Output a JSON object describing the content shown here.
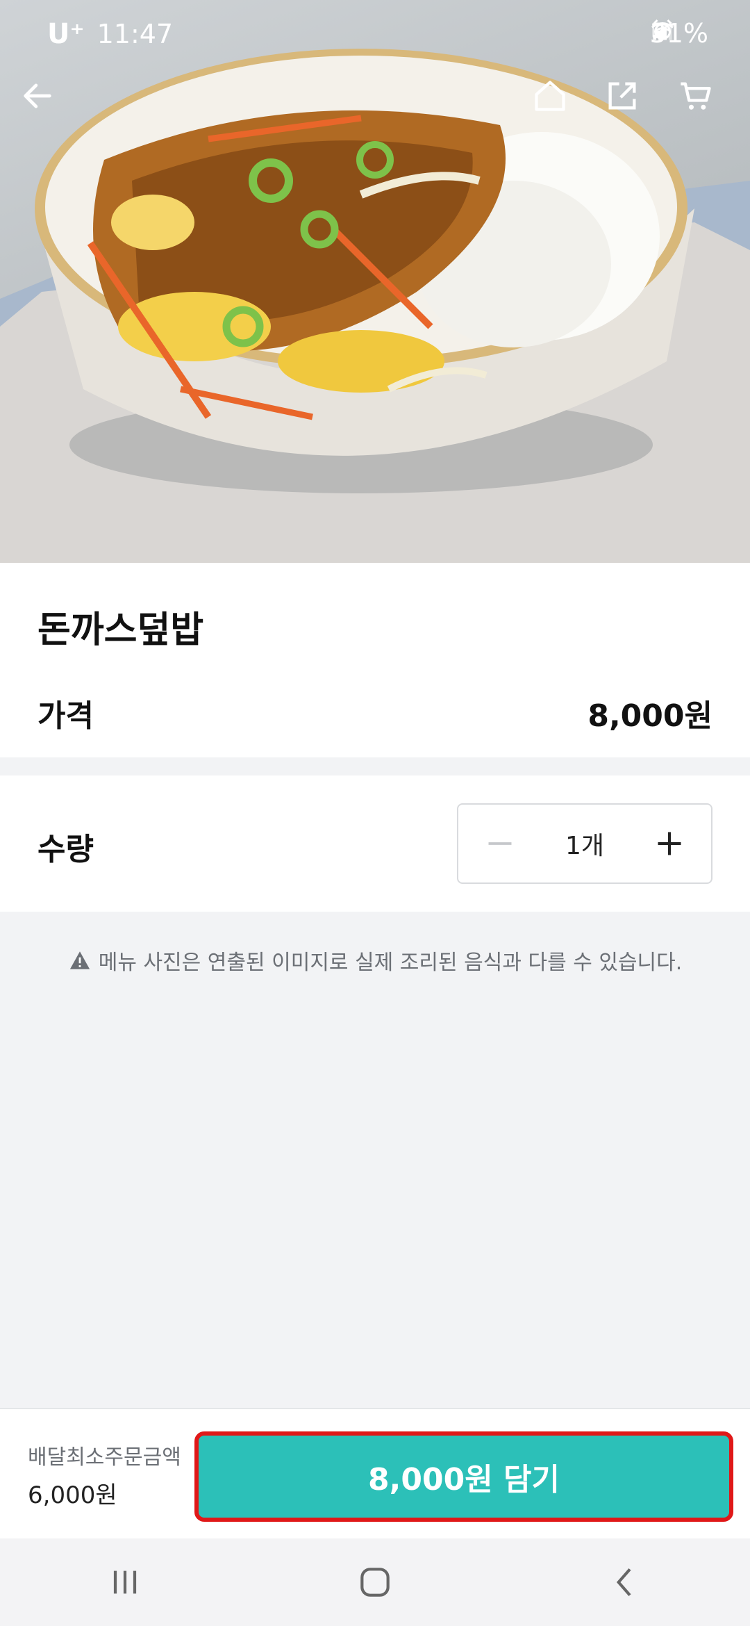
{
  "status_bar": {
    "carrier": "U⁺",
    "time": "11:47",
    "battery": "31%"
  },
  "nav": {
    "icons": [
      "back-arrow-icon",
      "home-icon",
      "share-icon",
      "cart-icon"
    ]
  },
  "menu": {
    "title": "돈까스덮밥",
    "price_label": "가격",
    "price_value": "8,000원"
  },
  "quantity": {
    "label": "수량",
    "value": "1개"
  },
  "notice": {
    "text": "메뉴 사진은 연출된 이미지로 실제 조리된 음식과 다를 수 있습니다."
  },
  "cart_bar": {
    "min_order_label": "배달최소주문금액",
    "min_order_value": "6,000원",
    "add_button_label": "8,000원 담기"
  },
  "colors": {
    "accent": "#2cc0b8",
    "highlight_border": "#e01818",
    "background": "#f2f3f5"
  }
}
